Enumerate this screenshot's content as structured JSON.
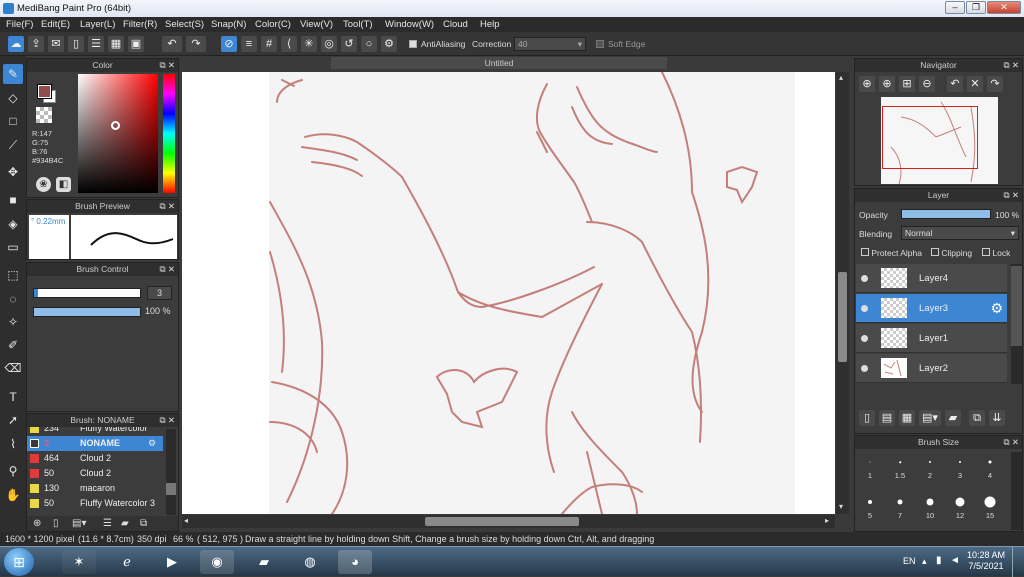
{
  "window": {
    "title": "MediBang Paint Pro (64bit)"
  },
  "menu": [
    "File(F)",
    "Edit(E)",
    "Layer(L)",
    "Filter(R)",
    "Select(S)",
    "Snap(N)",
    "Color(C)",
    "View(V)",
    "Tool(T)",
    "Window(W)",
    "Cloud",
    "Help"
  ],
  "toolbar": {
    "antialiasing_label": "AntiAliasing",
    "correction_label": "Correction",
    "correction_value": "40",
    "soft_edge_label": "Soft Edge"
  },
  "color_panel": {
    "title": "Color",
    "r": "R:147",
    "g": "G:75",
    "b": "B:76",
    "hex": "#934B4C",
    "primary": "#934B4C",
    "secondary": "#ffffff"
  },
  "brush_preview": {
    "title": "Brush Preview",
    "size": "° 0.22mm"
  },
  "brush_control": {
    "title": "Brush Control",
    "size_value": "3",
    "opacity_value": "100 %"
  },
  "brush_list": {
    "title": "Brush: NONAME",
    "items": [
      {
        "num": "234",
        "name": "Fluffy Watercolor",
        "color": "#e8d84a"
      },
      {
        "num": "3",
        "name": "NONAME",
        "color": "#3a3a3a"
      },
      {
        "num": "464",
        "name": "Cloud 2",
        "color": "#e03a3a"
      },
      {
        "num": "50",
        "name": "Cloud 2",
        "color": "#e03a3a"
      },
      {
        "num": "130",
        "name": "macaron",
        "color": "#e8d84a"
      },
      {
        "num": "50",
        "name": "Fluffy Watercolor 3",
        "color": "#e8d84a"
      }
    ],
    "selected_index": 1
  },
  "canvas": {
    "tab_title": "Untitled",
    "stroke_color": "#c47f7a"
  },
  "navigator": {
    "title": "Navigator"
  },
  "layer_panel": {
    "title": "Layer",
    "opacity_label": "Opacity",
    "opacity_value": "100 %",
    "opacity_level": 1.0,
    "blending_label": "Blending",
    "blending_value": "Normal",
    "protect_alpha": "Protect Alpha",
    "clipping": "Clipping",
    "lock": "Lock",
    "layers": [
      {
        "name": "Layer4"
      },
      {
        "name": "Layer3"
      },
      {
        "name": "Layer1"
      },
      {
        "name": "Layer2"
      }
    ],
    "selected_index": 1
  },
  "brush_size": {
    "title": "Brush Size",
    "sizes": [
      "1",
      "1.5",
      "2",
      "3",
      "4",
      "5",
      "7",
      "10",
      "12",
      "15"
    ]
  },
  "status": {
    "dimensions": "1600 * 1200 pixel",
    "physical": "(11.6 * 8.7cm)",
    "dpi": "350 dpi",
    "zoom": "66 %",
    "coords": "( 512, 975 )",
    "hint": "Draw a straight line by holding down Shift, Change a brush size by holding down Ctrl, Alt, and dragging"
  },
  "taskbar": {
    "lang": "EN",
    "time": "10:28 AM",
    "date": "7/5/2021"
  }
}
